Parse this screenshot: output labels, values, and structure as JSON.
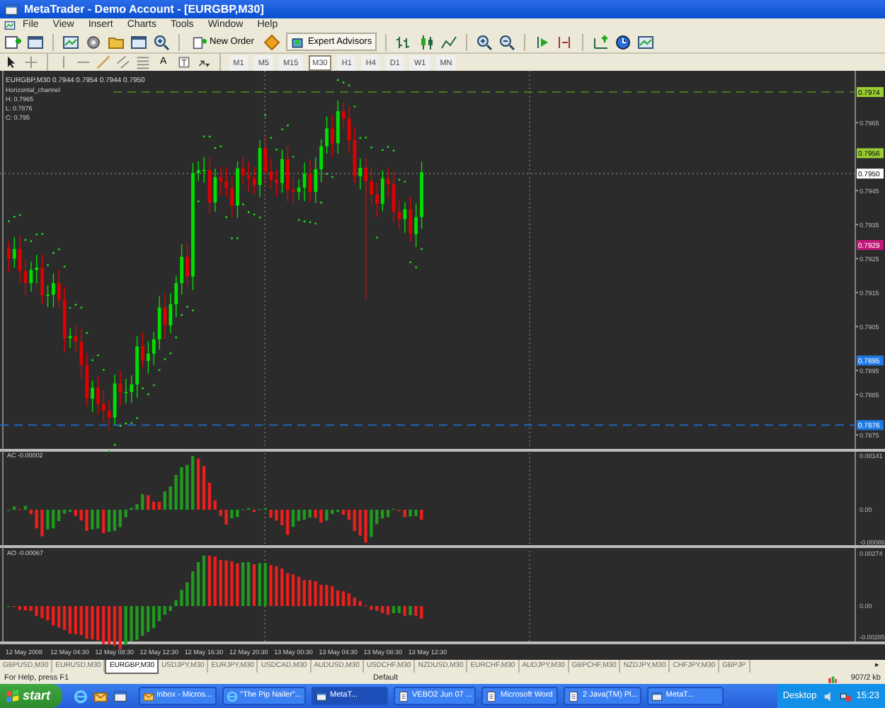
{
  "window": {
    "title": "MetaTrader - Demo Account - [EURGBP,M30]"
  },
  "menu": [
    "File",
    "View",
    "Insert",
    "Charts",
    "Tools",
    "Window",
    "Help"
  ],
  "toolbar": {
    "new_order": "New Order",
    "expert_advisors": "Expert Advisors",
    "text_tool": "A"
  },
  "timeframes": [
    {
      "label": "M1",
      "selected": false
    },
    {
      "label": "M5",
      "selected": false
    },
    {
      "label": "M15",
      "selected": false
    },
    {
      "label": "M30",
      "selected": true
    },
    {
      "label": "H1",
      "selected": false
    },
    {
      "label": "H4",
      "selected": false
    },
    {
      "label": "D1",
      "selected": false
    },
    {
      "label": "W1",
      "selected": false
    },
    {
      "label": "MN",
      "selected": false
    }
  ],
  "chart": {
    "header": "EURGBP,M30  0.7944 0.7954 0.7944 0.7950",
    "legend": [
      "Horizontal_channel",
      "H: 0.7965",
      "L: 0.7876",
      "C: 0.795"
    ],
    "ticks": [
      "0.7965",
      "0.7945",
      "0.7935",
      "0.7925",
      "0.7915",
      "0.7905",
      "0.7895",
      "0.7885",
      "0.7875"
    ],
    "markers": [
      {
        "text": "0.7974",
        "color": "#9acd32"
      },
      {
        "text": "0.7956",
        "color": "#9acd32"
      },
      {
        "text": "0.7950",
        "color": "#ffffff"
      },
      {
        "text": "0.7929",
        "color": "#c0187a"
      },
      {
        "text": "0.7895",
        "color": "#1e7be6"
      },
      {
        "text": "0.7876",
        "color": "#1e7be6"
      }
    ],
    "indicators": [
      {
        "label": "AC -0.00002",
        "scale": [
          "0.00141",
          "0.00",
          "-0.00086"
        ]
      },
      {
        "label": "AO -0.00067",
        "scale": [
          "0.00274",
          "0.00",
          "-0.00285"
        ]
      }
    ],
    "time_axis": [
      "12 May 2008",
      "12 May 04:30",
      "12 May 08:30",
      "12 May 12:30",
      "12 May 16:30",
      "12 May 20:30",
      "13 May 00:30",
      "13 May 04:30",
      "13 May 08:30",
      "13 May 12:30"
    ]
  },
  "symbol_tabs": [
    {
      "label": "GBPUSD,M30",
      "selected": false
    },
    {
      "label": "EURUSD,M30",
      "selected": false
    },
    {
      "label": "EURGBP,M30",
      "selected": true
    },
    {
      "label": "USDJPY,M30",
      "selected": false
    },
    {
      "label": "EURJPY,M30",
      "selected": false
    },
    {
      "label": "USDCAD,M30",
      "selected": false
    },
    {
      "label": "AUDUSD,M30",
      "selected": false
    },
    {
      "label": "USDCHF,M30",
      "selected": false
    },
    {
      "label": "NZDUSD,M30",
      "selected": false
    },
    {
      "label": "EURCHF,M30",
      "selected": false
    },
    {
      "label": "AUDJPY,M30",
      "selected": false
    },
    {
      "label": "GBPCHF,M30",
      "selected": false
    },
    {
      "label": "NZDJPY,M30",
      "selected": false
    },
    {
      "label": "CHFJPY,M30",
      "selected": false
    },
    {
      "label": "GBPJP",
      "selected": false
    }
  ],
  "tab_scroll": "▸",
  "status_bar": {
    "help": "For Help, press F1",
    "profile": "Default",
    "traffic": "907/2 kb"
  },
  "taskbar": {
    "start": "start",
    "tasks": [
      {
        "label": "Inbox - Micros...",
        "selected": false
      },
      {
        "label": "\"The Pip Nailer\"...",
        "selected": false
      },
      {
        "label": "MetaT...",
        "selected": true
      },
      {
        "label": "VEBO2 Jun 07 ...",
        "selected": false
      },
      {
        "label": "Microsoft Word",
        "selected": false
      },
      {
        "label": "2 Java(TM) Pl...",
        "selected": false
      },
      {
        "label": "MetaT...",
        "selected": false
      }
    ],
    "desktop": "Desktop",
    "clock": "15:23"
  }
}
